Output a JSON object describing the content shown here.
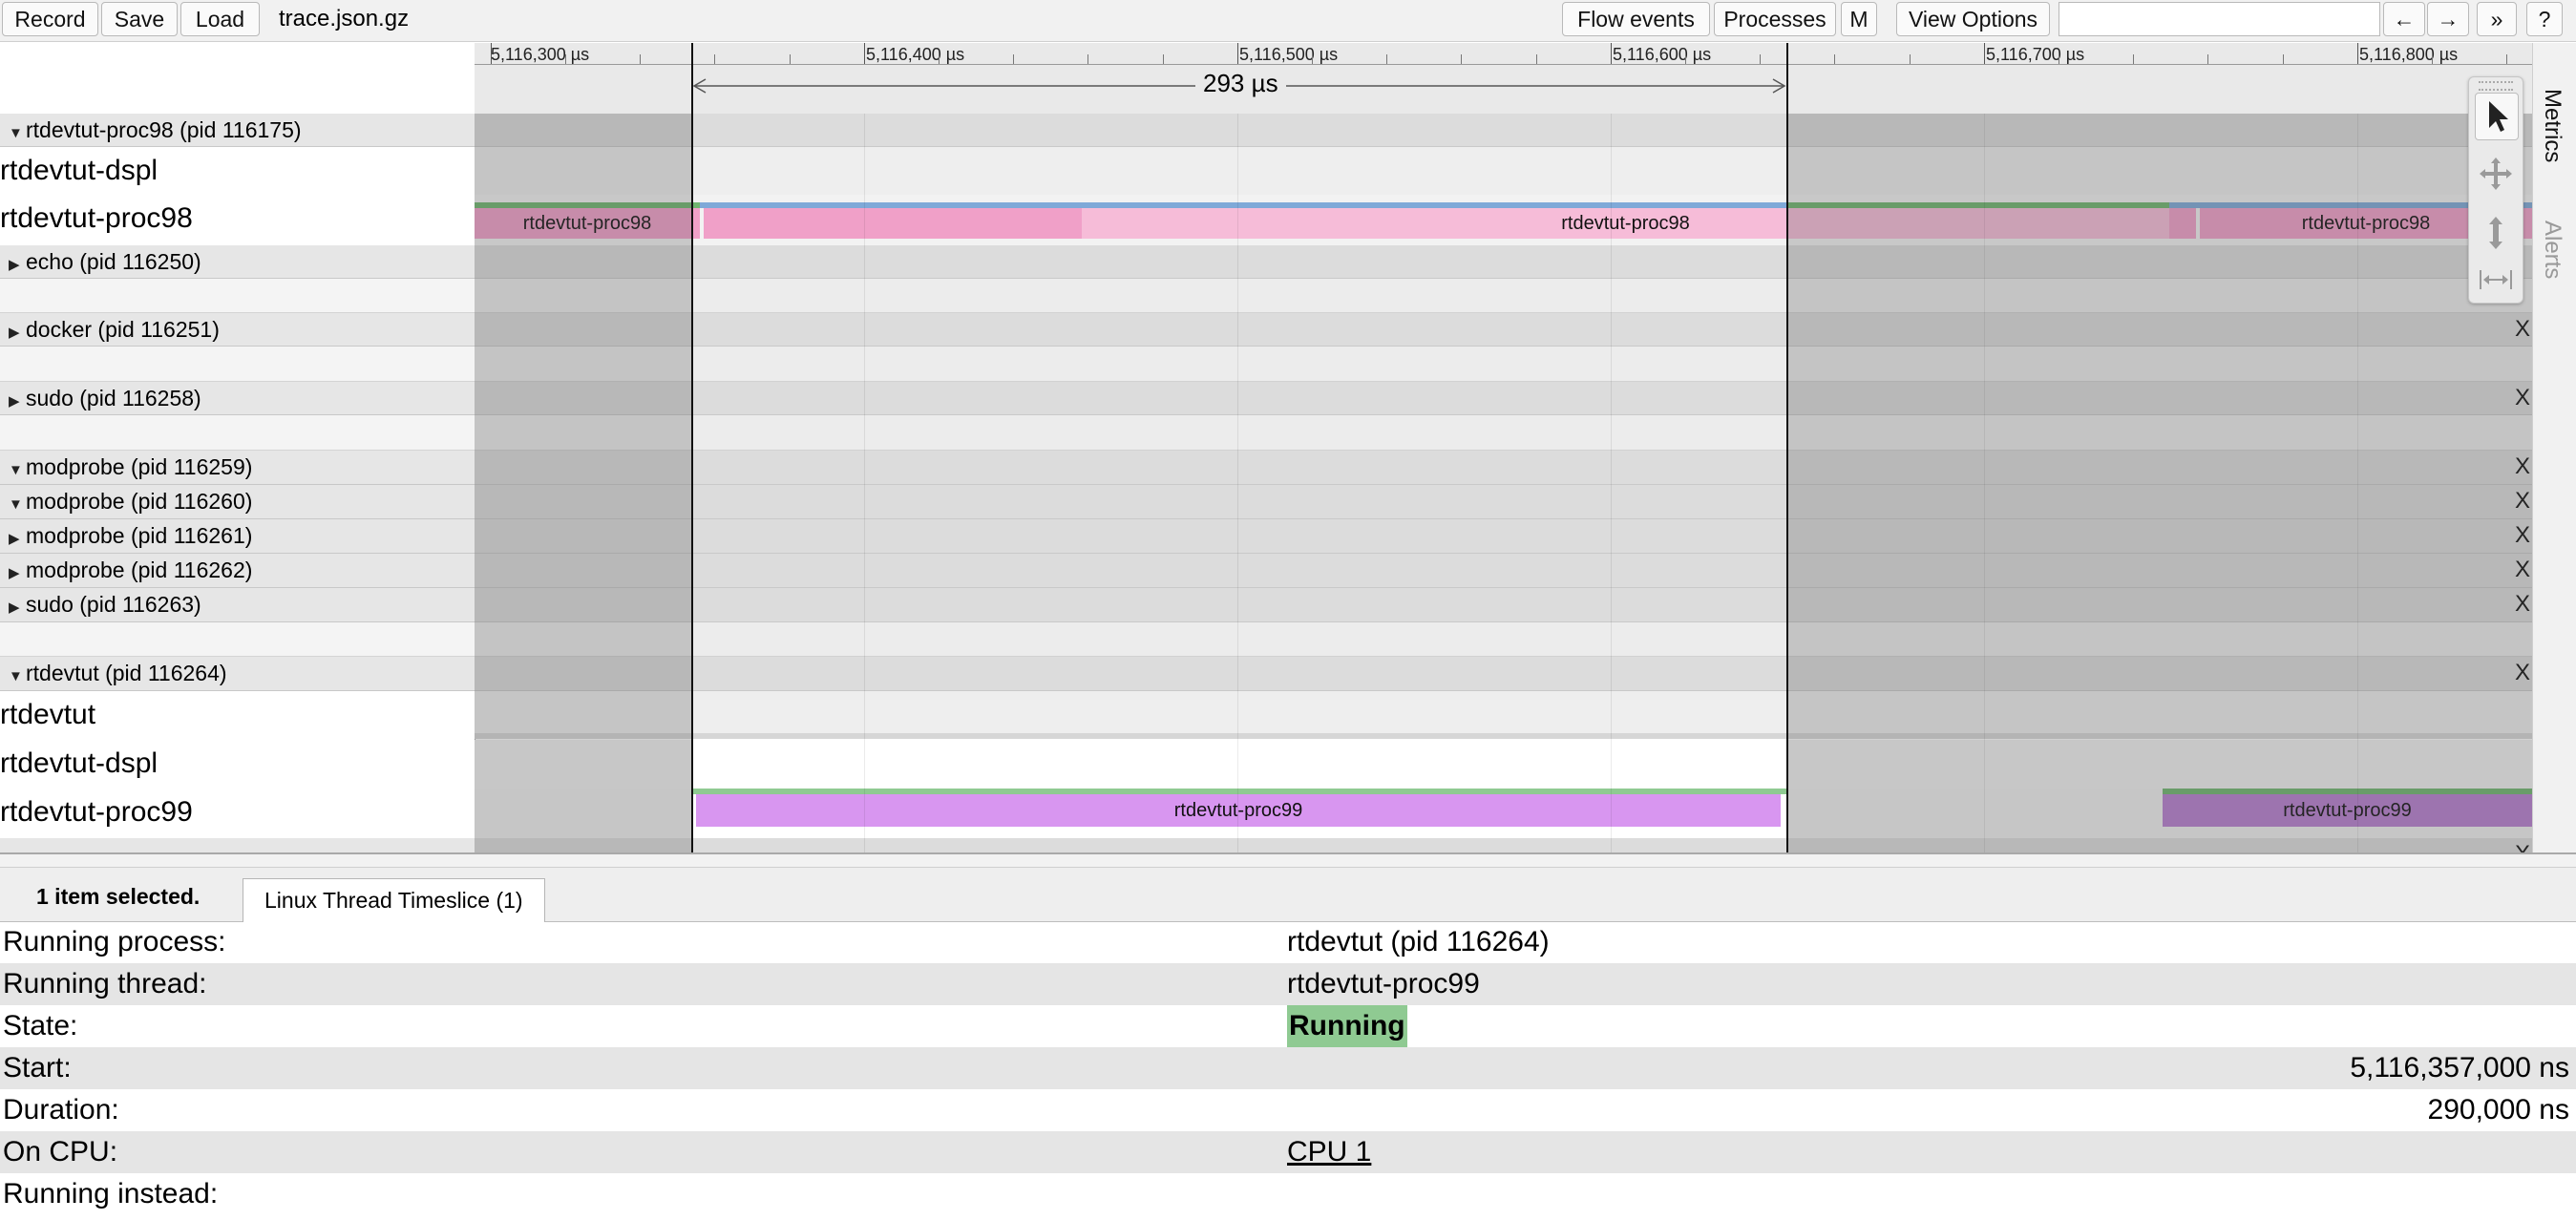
{
  "toolbar": {
    "record": "Record",
    "save": "Save",
    "load": "Load",
    "file_name": "trace.json.gz",
    "flow_events": "Flow events",
    "processes": "Processes",
    "m": "M",
    "view_options": "View Options",
    "prev": "←",
    "next": "→",
    "more": "»",
    "help": "?"
  },
  "ruler": {
    "ticks": [
      "5,116,300 µs",
      "5,116,400 µs",
      "5,116,500 µs",
      "5,116,600 µs",
      "5,116,700 µs",
      "5,116,800 µs"
    ],
    "selection_duration": "293 µs"
  },
  "rows": {
    "rtdevtut_proc98_process": "rtdevtut-proc98 (pid 116175)",
    "thread_dspl_1": "rtdevtut-dspl",
    "thread_proc98": "rtdevtut-proc98",
    "echo": "echo (pid 116250)",
    "docker": "docker (pid 116251)",
    "sudo_1": "sudo (pid 116258)",
    "modprobe_1": "modprobe (pid 116259)",
    "modprobe_2": "modprobe (pid 116260)",
    "modprobe_3": "modprobe (pid 116261)",
    "modprobe_4": "modprobe (pid 116262)",
    "sudo_2": "sudo (pid 116263)",
    "rtdevtut_process": "rtdevtut (pid 116264)",
    "thread_rtdevtut": "rtdevtut",
    "thread_dspl_2": "rtdevtut-dspl",
    "thread_proc99": "rtdevtut-proc99"
  },
  "slices": {
    "proc98_left": "rtdevtut-proc98",
    "proc98_mid": "rtdevtut-proc98",
    "proc98_right": "rtdevtut-proc98",
    "proc99_mid": "rtdevtut-proc99",
    "proc99_right": "rtdevtut-proc99"
  },
  "close_mark": "X",
  "side_tabs": {
    "metrics": "Metrics",
    "alerts": "Alerts"
  },
  "tool_icons": [
    "pointer-icon",
    "pan-icon",
    "zoom-icon",
    "timing-icon"
  ],
  "analysis": {
    "selection_count": "1 item selected.",
    "tab_label": "Linux Thread Timeslice (1)",
    "running_process_key": "Running process:",
    "running_process_val": "rtdevtut (pid 116264)",
    "running_thread_key": "Running thread:",
    "running_thread_val": "rtdevtut-proc99",
    "state_key": "State:",
    "state_val": "Running",
    "start_key": "Start:",
    "start_val": "5,116,357,000 ns",
    "duration_key": "Duration:",
    "duration_val": "290,000 ns",
    "on_cpu_key": "On CPU:",
    "on_cpu_val": "CPU 1",
    "running_instead_key": "Running instead:"
  },
  "colors": {
    "proc98": "#f0a0c8",
    "proc98_light": "#f6bcd8",
    "proc99": "#d896f0",
    "proc99_dark": "#b77ed0",
    "running_state": "#8fca92"
  }
}
